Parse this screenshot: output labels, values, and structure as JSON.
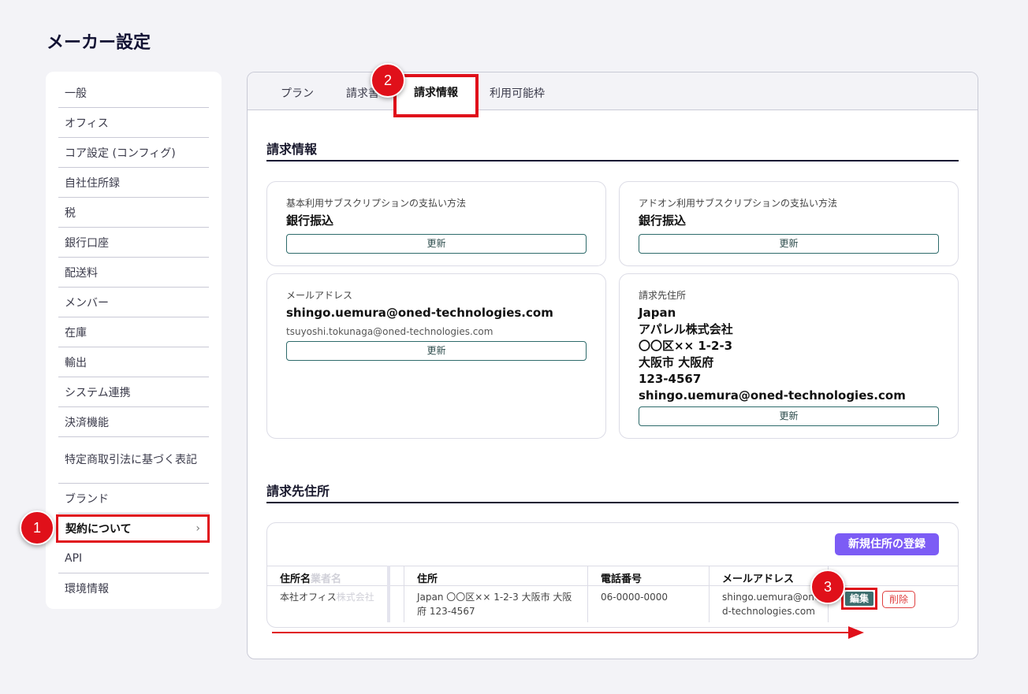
{
  "page": {
    "title": "メーカー設定"
  },
  "sidebar": {
    "items": [
      {
        "label": "一般"
      },
      {
        "label": "オフィス"
      },
      {
        "label": "コア設定 (コンフィグ)"
      },
      {
        "label": "自社住所録"
      },
      {
        "label": "税"
      },
      {
        "label": "銀行口座"
      },
      {
        "label": "配送料"
      },
      {
        "label": "メンバー"
      },
      {
        "label": "在庫"
      },
      {
        "label": "輸出"
      },
      {
        "label": "システム連携"
      },
      {
        "label": "決済機能"
      },
      {
        "label": "特定商取引法に基づく表記"
      },
      {
        "label": "ブランド"
      },
      {
        "label": "契約について",
        "chevron": "›"
      },
      {
        "label": "API"
      },
      {
        "label": "環境情報"
      }
    ]
  },
  "tabs": [
    {
      "label": "プラン"
    },
    {
      "label": "請求書"
    },
    {
      "label": "請求情報"
    },
    {
      "label": "利用可能枠"
    }
  ],
  "billing": {
    "title": "請求情報",
    "update_label": "更新",
    "base_payment": {
      "label": "基本利用サブスクリプションの支払い方法",
      "value": "銀行振込"
    },
    "addon_payment": {
      "label": "アドオン利用サブスクリプションの支払い方法",
      "value": "銀行振込"
    },
    "email": {
      "label": "メールアドレス",
      "value": "shingo.uemura@oned-technologies.com",
      "cc": "tsuyoshi.tokunaga@oned-technologies.com"
    },
    "address": {
      "label": "請求先住所",
      "lines": [
        "Japan",
        "アパレル株式会社",
        "〇〇区×× 1-2-3",
        "大阪市 大阪府",
        "123-4567",
        "shingo.uemura@oned-technologies.com"
      ]
    }
  },
  "addresses": {
    "title": "請求先住所",
    "new_button": "新規住所の登録",
    "columns": {
      "name": "住所名",
      "name_ghost": "業者名",
      "address": "住所",
      "phone": "電話番号",
      "email": "メールアドレス"
    },
    "rows": [
      {
        "name": "本社オフィス",
        "name_ghost": "株式会社",
        "address_line1": "Japan 〇〇区×× 1-2-3 大阪市 大阪",
        "address_line2": "府 123-4567",
        "phone": "06-0000-0000",
        "email_line1": "shingo.uemura@oned-",
        "email_line2": "d-technologies.com",
        "edit": "編集",
        "delete": "削除"
      }
    ]
  },
  "annotations": {
    "step1": "1",
    "step2": "2",
    "step3": "3"
  },
  "colors": {
    "highlight": "#e0101a",
    "primary_button": "#7c5cf5",
    "edit_button": "#3d6e6e",
    "delete": "#e04040"
  }
}
